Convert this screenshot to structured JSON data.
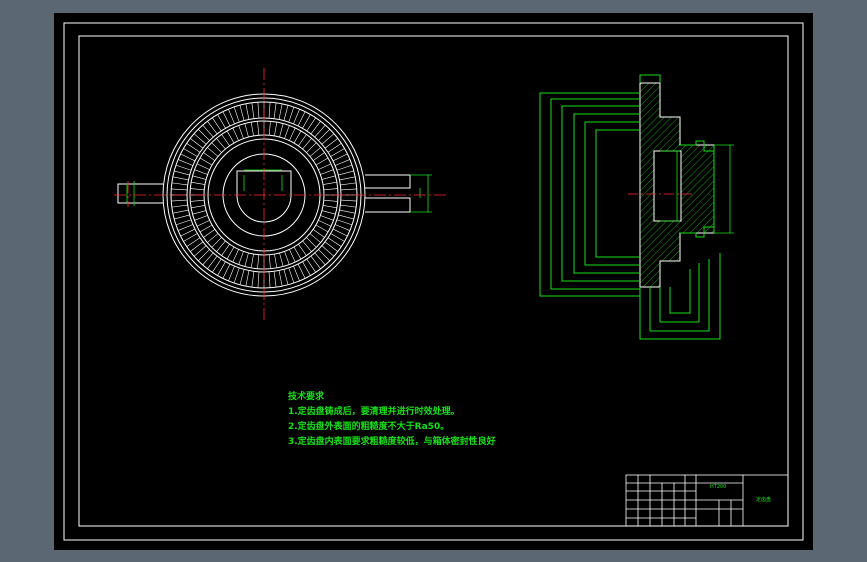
{
  "technical_requirements": {
    "heading": "技术要求",
    "items": [
      "1.定齿盘铸成后，要清理并进行时效处理。",
      "2.定齿盘外表面的粗糙度不大于Ra50。",
      "3.定齿盘内表面要求粗糙度较低，与箱体密封性良好"
    ]
  },
  "title_block": {
    "part_name": "定齿盘",
    "material": "HT200"
  },
  "colors": {
    "background": "#000000",
    "border": "#ffffff",
    "text": "#16e016",
    "center_line": "#ff2a2a",
    "dimension": "#16e016",
    "outer_chrome": "#5b6773"
  }
}
